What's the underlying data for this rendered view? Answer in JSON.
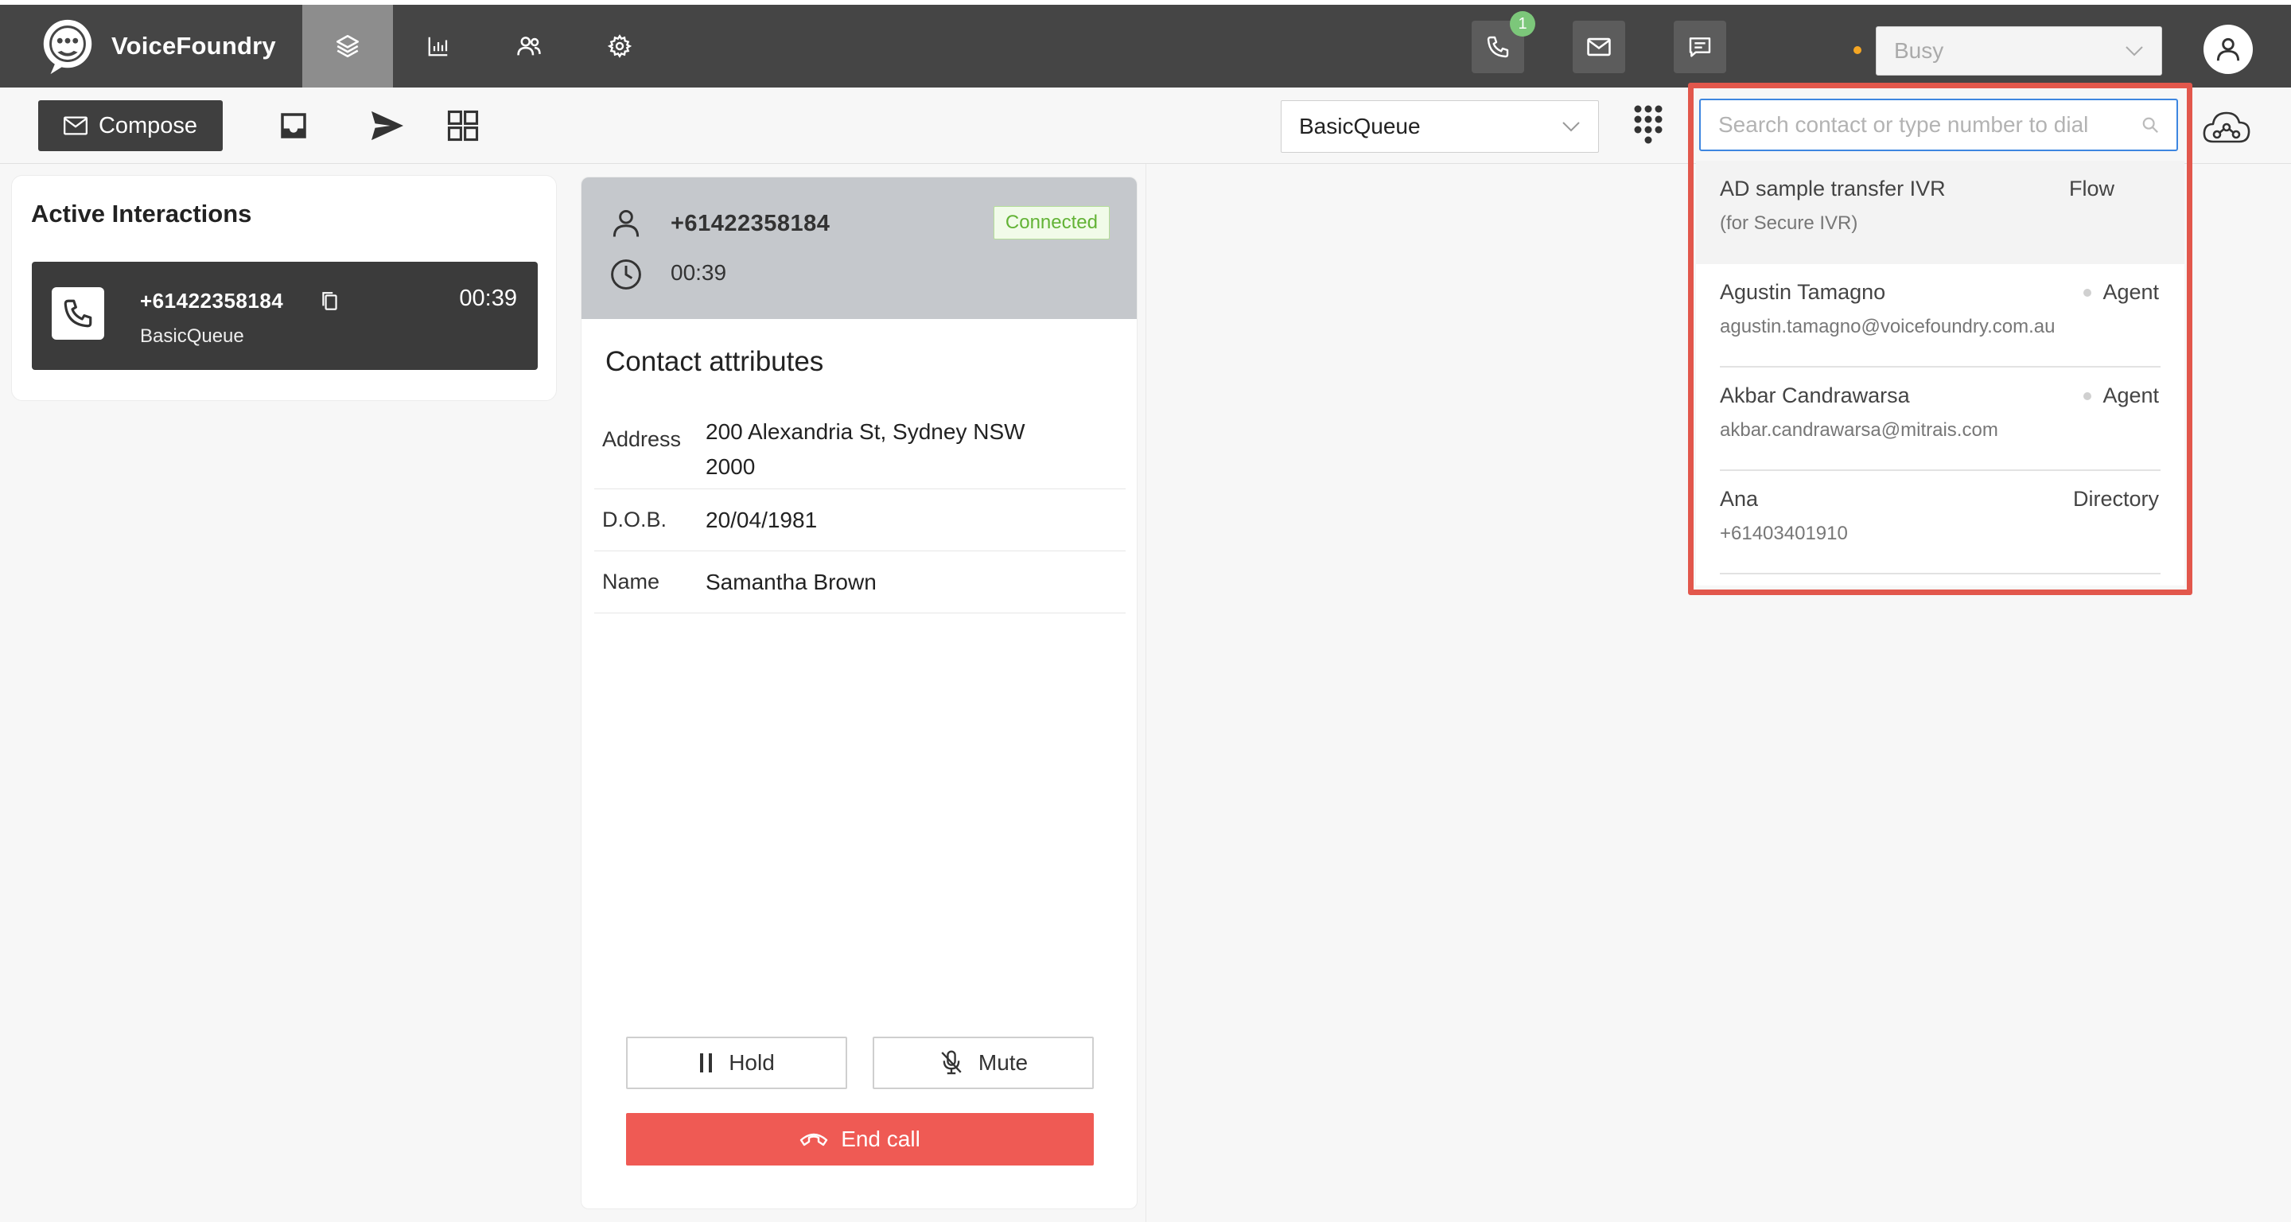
{
  "app": {
    "name": "VoiceFoundry"
  },
  "header": {
    "nav": [
      "workspace-icon",
      "analytics-icon",
      "users-icon",
      "settings-icon"
    ],
    "phone_badge": "1",
    "status": {
      "value": "Busy",
      "dot_color": "#f5a623"
    }
  },
  "toolbar": {
    "compose_label": "Compose",
    "queue": "BasicQueue",
    "search": {
      "placeholder": "Search contact or type number to dial",
      "value": ""
    }
  },
  "dropdown": {
    "items": [
      {
        "title": "AD sample transfer IVR",
        "sub": "(for Secure IVR)",
        "type": "Flow"
      },
      {
        "title": "Agustin Tamagno",
        "sub": "agustin.tamagno@voicefoundry.com.au",
        "type": "Agent"
      },
      {
        "title": "Akbar Candrawarsa",
        "sub": "akbar.candrawarsa@mitrais.com",
        "type": "Agent"
      },
      {
        "title": "Ana",
        "sub": "+61403401910",
        "type": "Directory"
      }
    ]
  },
  "active_interactions": {
    "title": "Active Interactions",
    "card": {
      "number": "+61422358184",
      "queue": "BasicQueue",
      "timer": "00:39"
    }
  },
  "contact": {
    "number": "+61422358184",
    "time": "00:39",
    "status": "Connected",
    "attributes_title": "Contact attributes",
    "attributes": [
      {
        "key": "Address",
        "value": "200 Alexandria St, Sydney NSW 2000"
      },
      {
        "key": "D.O.B.",
        "value": "20/04/1981"
      },
      {
        "key": "Name",
        "value": "Samantha Brown"
      }
    ],
    "actions": {
      "hold": "Hold",
      "mute": "Mute",
      "end": "End call"
    }
  },
  "colors": {
    "accent_red": "#ef5a54",
    "highlight": "#e2574c",
    "connected": "#63b336",
    "topbar": "#454545"
  }
}
